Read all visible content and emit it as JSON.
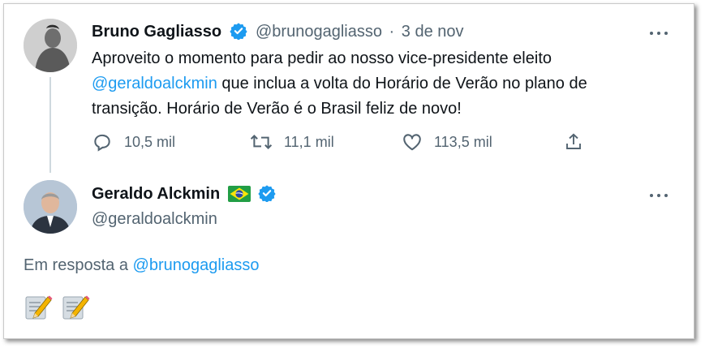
{
  "tweet1": {
    "author_name": "Bruno Gagliasso",
    "handle": "@brunogagliasso",
    "separator": "·",
    "date": "3 de nov",
    "text_before": "Aproveito o momento para pedir ao nosso vice-presidente eleito",
    "mention": "@geraldoalckmin",
    "text_after": " que inclua a volta do Horário de Verão no plano de transição. Horário de Verão é o Brasil feliz de novo!",
    "replies": "10,5 mil",
    "retweets": "11,1 mil",
    "likes": "113,5 mil"
  },
  "tweet2": {
    "author_name": "Geraldo Alckmin",
    "flag": "brazil-flag-icon",
    "handle": "@geraldoalckmin",
    "reply_prefix": "Em resposta a ",
    "reply_mention": "@brunogagliasso",
    "emojis": [
      "memo-icon",
      "memo-icon"
    ]
  },
  "colors": {
    "accent": "#1d9bf0",
    "text": "#0f1419",
    "secondary": "#536471",
    "thread_line": "#cfd9de"
  }
}
